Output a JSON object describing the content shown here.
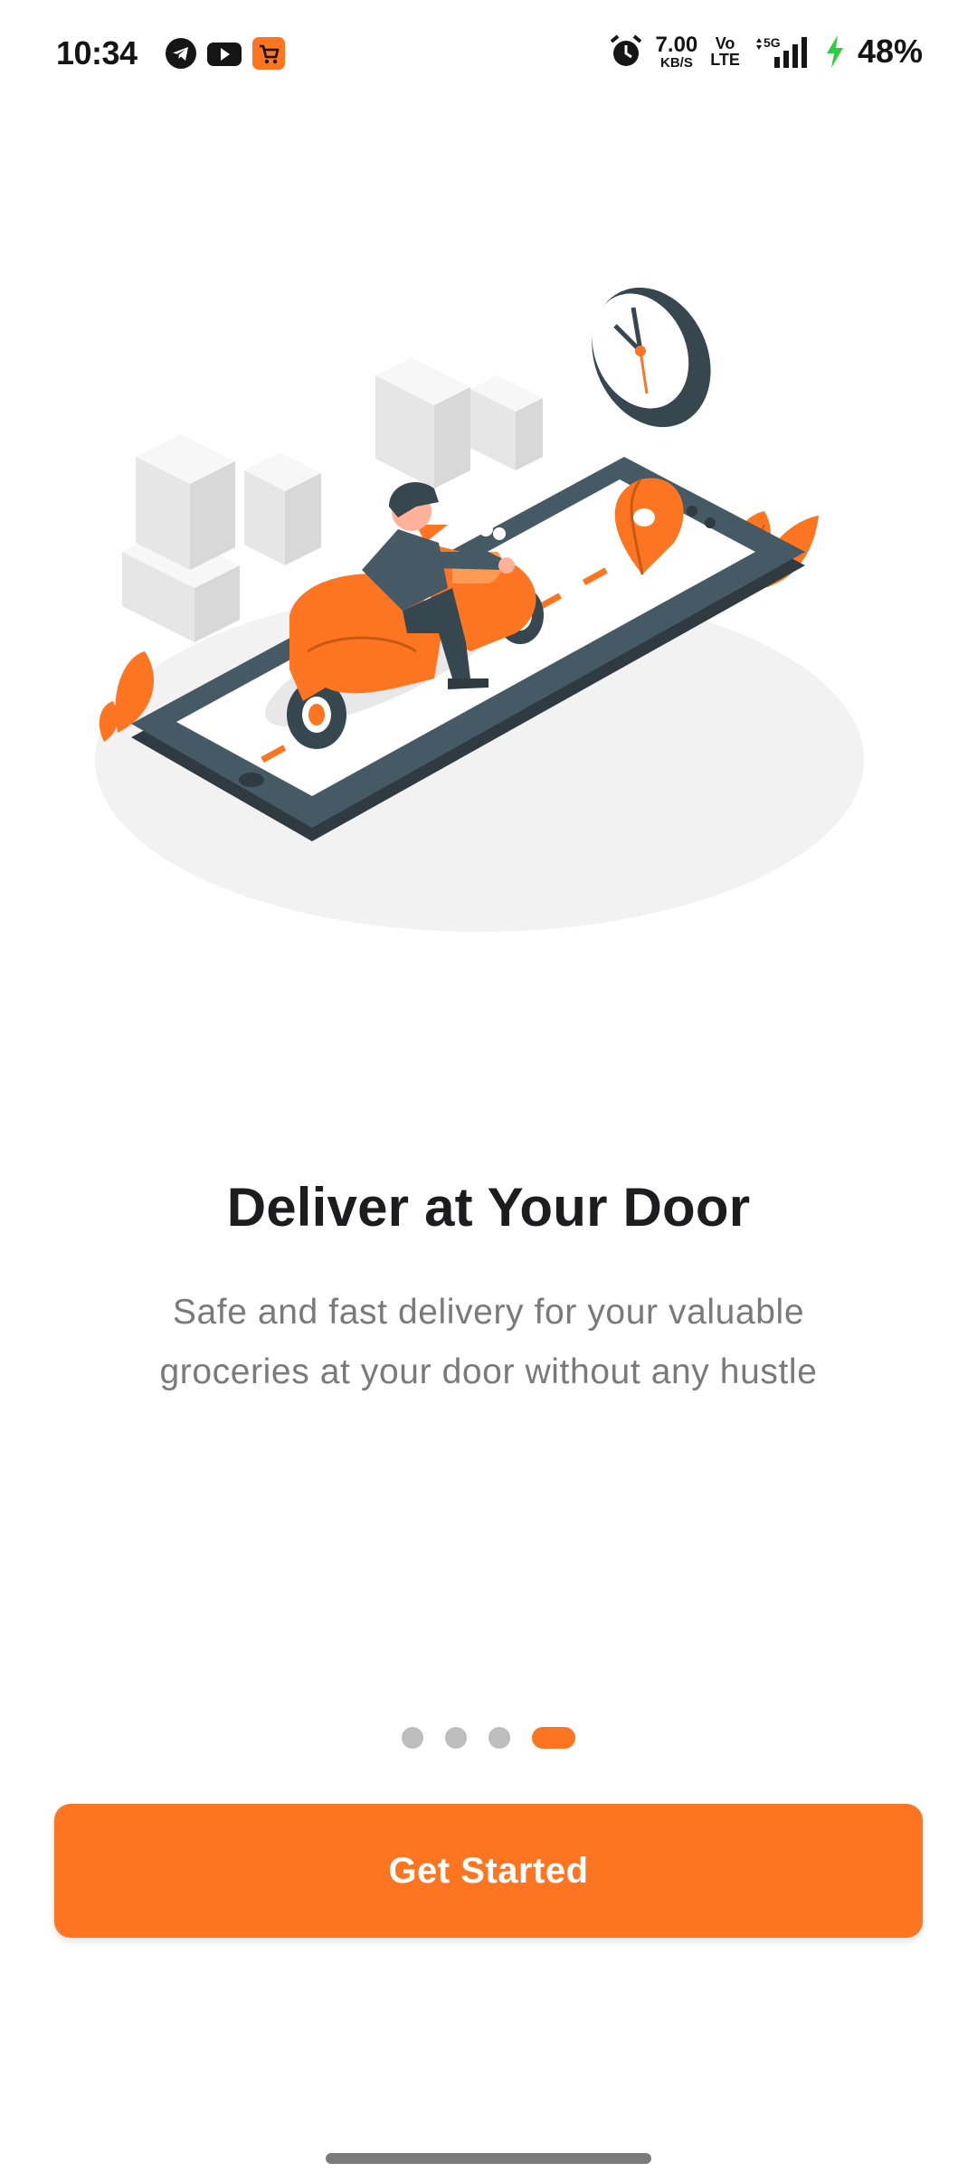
{
  "status_bar": {
    "time": "10:34",
    "apps": [
      "telegram-icon",
      "youtube-icon",
      "shop-cart-icon"
    ],
    "network_speed": "7.00",
    "network_speed_unit": "KB/S",
    "volte_top": "Vo",
    "volte_bottom": "LTE",
    "network_type": "5G",
    "battery": "48%"
  },
  "onboarding": {
    "title": "Deliver at Your Door",
    "description": "Safe and fast delivery for your valuable groceries at your door without any hustle",
    "page_count": 4,
    "active_page": 4
  },
  "actions": {
    "get_started_label": "Get Started"
  },
  "colors": {
    "accent": "#fd7520",
    "dot_inactive": "#bdbdbd",
    "title": "#1d1d1f",
    "body_text": "#7a7a7a"
  }
}
